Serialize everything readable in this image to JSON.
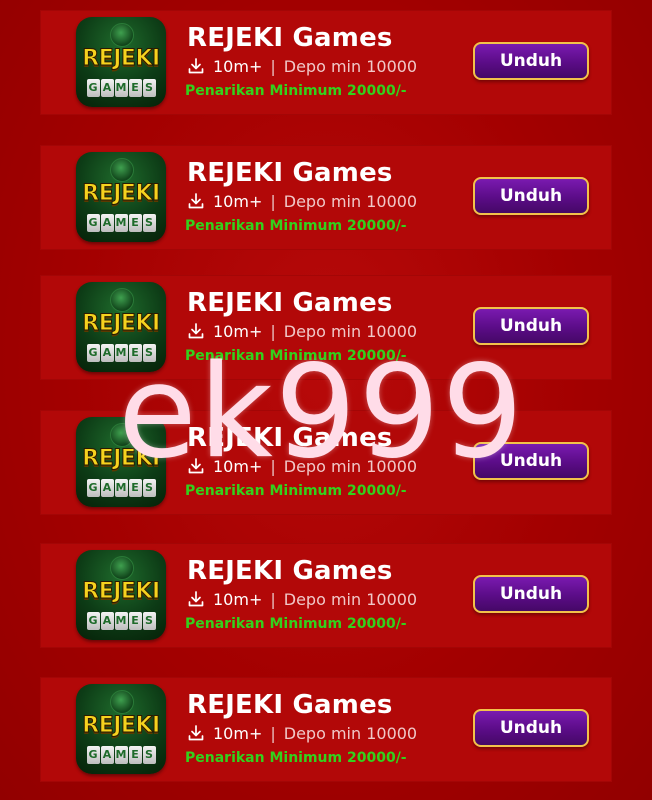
{
  "watermark": "ek999",
  "colors": {
    "background": "#a40000",
    "card": "#b20808",
    "button": "#5b0c87",
    "button_border": "#f2c24a",
    "withdraw_text": "#33d11c"
  },
  "apps": [
    {
      "icon": "rejeki-games-logo",
      "logo_word": "REJEKI",
      "logo_letters": [
        "G",
        "A",
        "M",
        "E",
        "S"
      ],
      "title": "REJEKI Games",
      "downloads_icon": "download-icon",
      "downloads": "10m+",
      "separator": "|",
      "deposit": "Depo min 10000",
      "withdraw": "Penarikan Minimum 20000/-",
      "button_label": "Unduh"
    },
    {
      "icon": "rejeki-games-logo",
      "logo_word": "REJEKI",
      "logo_letters": [
        "G",
        "A",
        "M",
        "E",
        "S"
      ],
      "title": "REJEKI Games",
      "downloads_icon": "download-icon",
      "downloads": "10m+",
      "separator": "|",
      "deposit": "Depo min 10000",
      "withdraw": "Penarikan Minimum 20000/-",
      "button_label": "Unduh"
    },
    {
      "icon": "rejeki-games-logo",
      "logo_word": "REJEKI",
      "logo_letters": [
        "G",
        "A",
        "M",
        "E",
        "S"
      ],
      "title": "REJEKI Games",
      "downloads_icon": "download-icon",
      "downloads": "10m+",
      "separator": "|",
      "deposit": "Depo min 10000",
      "withdraw": "Penarikan Minimum 20000/-",
      "button_label": "Unduh"
    },
    {
      "icon": "rejeki-games-logo",
      "logo_word": "REJEKI",
      "logo_letters": [
        "G",
        "A",
        "M",
        "E",
        "S"
      ],
      "title": "REJEKI Games",
      "downloads_icon": "download-icon",
      "downloads": "10m+",
      "separator": "|",
      "deposit": "Depo min 10000",
      "withdraw": "Penarikan Minimum 20000/-",
      "button_label": "Unduh"
    },
    {
      "icon": "rejeki-games-logo",
      "logo_word": "REJEKI",
      "logo_letters": [
        "G",
        "A",
        "M",
        "E",
        "S"
      ],
      "title": "REJEKI Games",
      "downloads_icon": "download-icon",
      "downloads": "10m+",
      "separator": "|",
      "deposit": "Depo min 10000",
      "withdraw": "Penarikan Minimum 20000/-",
      "button_label": "Unduh"
    },
    {
      "icon": "rejeki-games-logo",
      "logo_word": "REJEKI",
      "logo_letters": [
        "G",
        "A",
        "M",
        "E",
        "S"
      ],
      "title": "REJEKI Games",
      "downloads_icon": "download-icon",
      "downloads": "10m+",
      "separator": "|",
      "deposit": "Depo min 10000",
      "withdraw": "Penarikan Minimum 20000/-",
      "button_label": "Unduh"
    }
  ]
}
